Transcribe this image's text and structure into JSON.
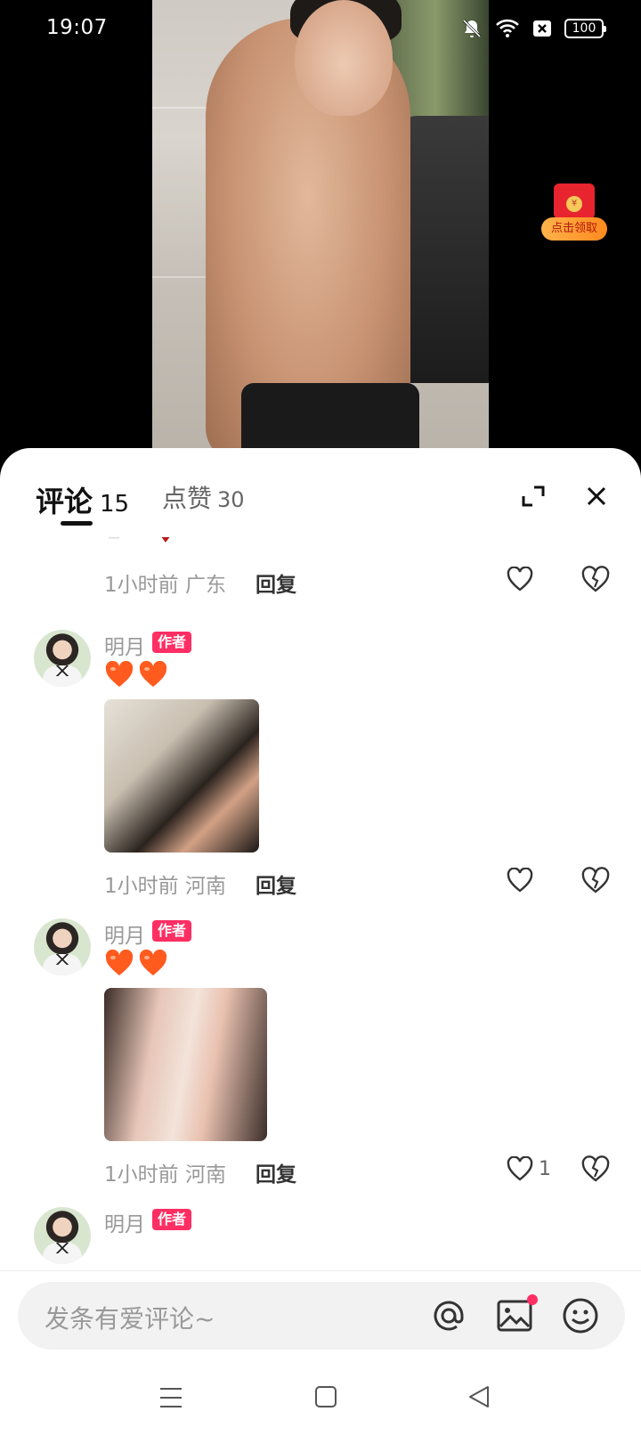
{
  "status_bar": {
    "time": "19:07",
    "battery": "100",
    "icons": [
      "mute-bell-icon",
      "wifi-icon",
      "no-sim-icon",
      "battery-icon"
    ]
  },
  "red_packet": {
    "label": "点击领取",
    "coin_symbol": "¥"
  },
  "sheet": {
    "tabs": [
      {
        "label": "评论",
        "count": "15",
        "active": true
      },
      {
        "label": "点赞",
        "count": "30",
        "active": false
      }
    ]
  },
  "comments": [
    {
      "partial": true,
      "time_location": "1小时前 广东",
      "reply_label": "回复",
      "likes": ""
    },
    {
      "username": "明月",
      "badge": "作者",
      "text_emoji": "🧡🧡",
      "image": "couple-photo-1",
      "time_location": "1小时前 河南",
      "reply_label": "回复",
      "likes": ""
    },
    {
      "username": "明月",
      "badge": "作者",
      "text_emoji": "🧡🧡",
      "image": "couple-photo-2",
      "time_location": "1小时前 河南",
      "reply_label": "回复",
      "likes": "1"
    },
    {
      "username": "明月",
      "badge": "作者",
      "partial": true
    }
  ],
  "input": {
    "placeholder": "发条有爱评论~"
  },
  "colors": {
    "accent_pink": "#ff2e63",
    "text_gray": "#999999",
    "sheet_bg": "#ffffff"
  }
}
